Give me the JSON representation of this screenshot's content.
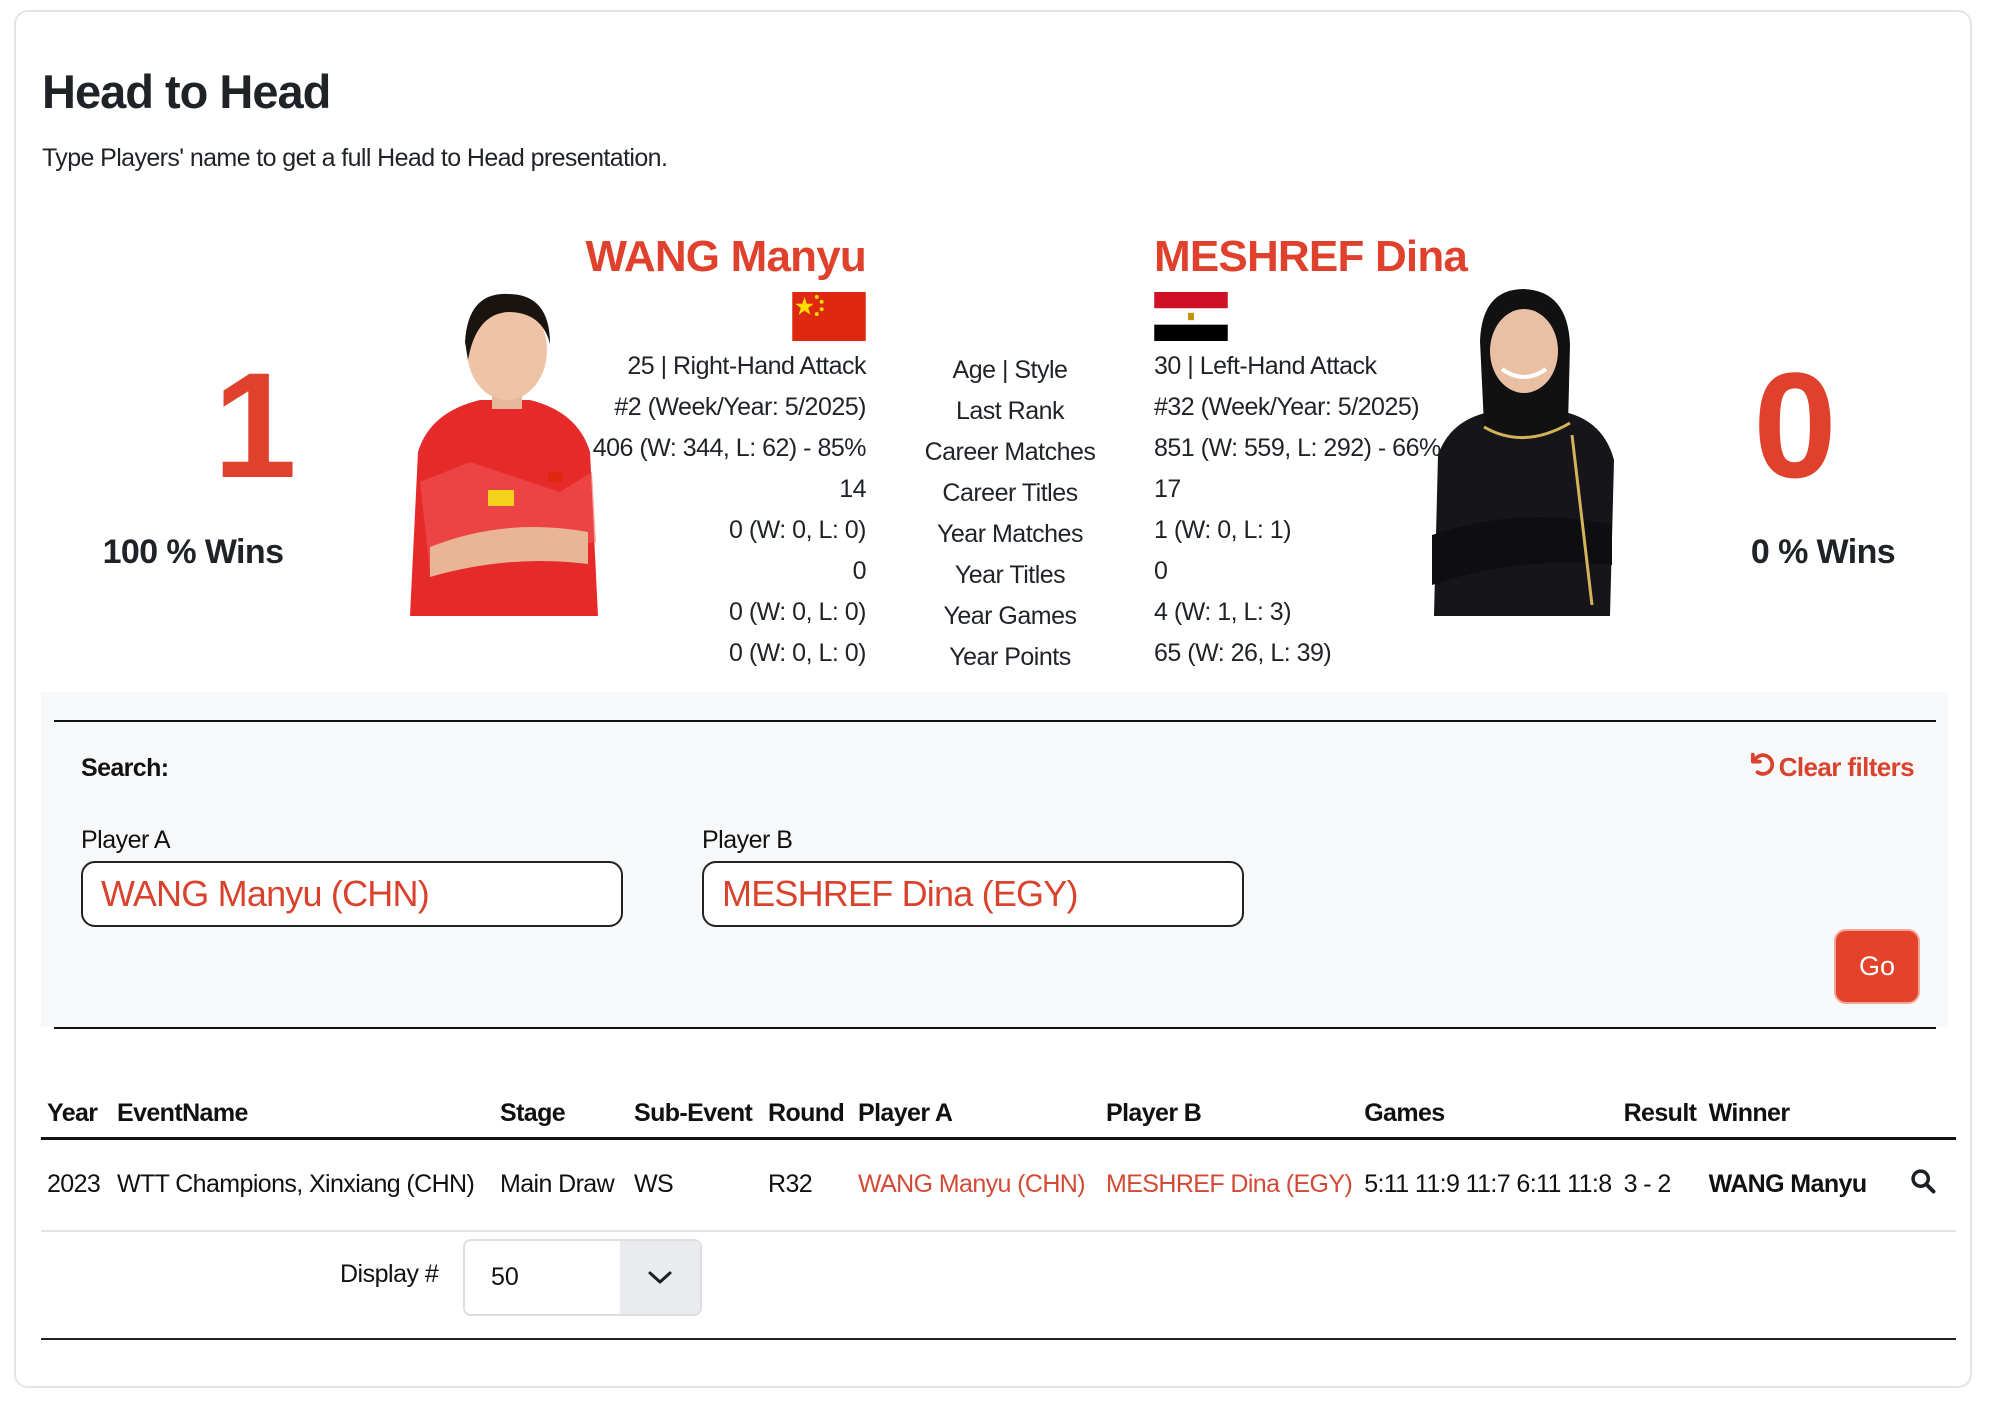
{
  "header": {
    "title": "Head to Head",
    "subtitle": "Type Players' name to get a full Head to Head presentation."
  },
  "h2h": {
    "player_a": {
      "name": "WANG Manyu",
      "country": "CHN",
      "flag_icon": "china-flag-icon",
      "score": "1",
      "wins_pct": "100 % Wins",
      "stats": [
        "25 | Right-Hand Attack",
        "#2 (Week/Year: 5/2025)",
        "406 (W: 344, L: 62) - 85%",
        "14",
        "0 (W: 0, L: 0)",
        "0",
        "0 (W: 0, L: 0)",
        "0 (W: 0, L: 0)"
      ]
    },
    "player_b": {
      "name": "MESHREF Dina",
      "country": "EGY",
      "flag_icon": "egypt-flag-icon",
      "score": "0",
      "wins_pct": "0 % Wins",
      "stats": [
        "30 | Left-Hand Attack",
        "#32 (Week/Year: 5/2025)",
        "851 (W: 559, L: 292) - 66%",
        "17",
        "1 (W: 0, L: 1)",
        "0",
        "4 (W: 1, L: 3)",
        "65 (W: 26, L: 39)"
      ]
    },
    "stat_labels": [
      "Age | Style",
      "Last Rank",
      "Career Matches",
      "Career Titles",
      "Year Matches",
      "Year Titles",
      "Year Games",
      "Year Points"
    ]
  },
  "search": {
    "label": "Search:",
    "clear_filters": "Clear filters",
    "player_a_label": "Player A",
    "player_a_value": "WANG Manyu (CHN)",
    "player_b_label": "Player B",
    "player_b_value": "MESHREF Dina (EGY)",
    "go_label": "Go"
  },
  "table": {
    "columns": [
      "Year",
      "EventName",
      "Stage",
      "Sub-Event",
      "Round",
      "Player A",
      "Player B",
      "Games",
      "Result",
      "Winner"
    ],
    "rows": [
      {
        "year": "2023",
        "event": "WTT Champions, Xinxiang (CHN)",
        "stage": "Main Draw",
        "sub_event": "WS",
        "round": "R32",
        "player_a": "WANG Manyu (CHN)",
        "player_b": "MESHREF Dina (EGY)",
        "games": "5:11 11:9 11:7 6:11 11:8",
        "result": "3 - 2",
        "winner": "WANG Manyu"
      }
    ]
  },
  "pagination": {
    "display_label": "Display #",
    "display_value": "50"
  },
  "colors": {
    "accent": "#e0412c",
    "panel_bg": "#f7f8fa"
  }
}
